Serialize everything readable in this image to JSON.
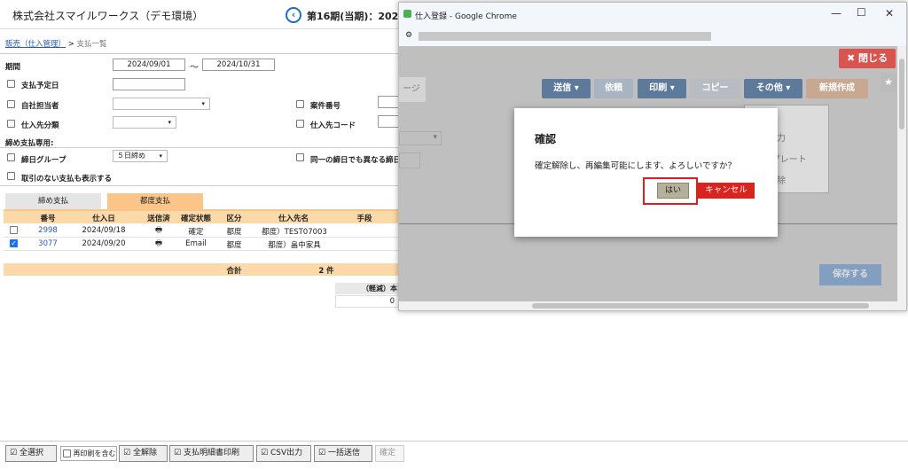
{
  "app": {
    "company": "株式会社スマイルワークス（デモ環境）",
    "period_title": "第16期(当期)：2024",
    "back_icon": "chevron-left-icon"
  },
  "breadcrumb": {
    "parent": "販売（仕入管理）",
    "separator": ">",
    "current": "支払一覧"
  },
  "filters": {
    "period_label": "期間",
    "period_from": "2024/09/01",
    "period_tilde": "～",
    "period_to": "2024/10/31",
    "due_date_label": "支払予定日",
    "staff_label": "自社担当者",
    "case_no_label": "案件番号",
    "supplier_type_label": "仕入先分類",
    "supplier_code_label": "仕入先コード",
    "closing_section": "締め支払専用:",
    "closing_group_label": "締日グループ",
    "closing_group_value": "５日締め",
    "same_closing_label": "同一の締日でも異なる締日",
    "show_no_txn_label": "取引のない支払も表示する"
  },
  "tabs": [
    "締め支払",
    "都度支払"
  ],
  "table": {
    "headers": [
      "番号",
      "仕入日",
      "送信済",
      "確定状態",
      "区分",
      "仕入先名",
      "手段"
    ],
    "rows": [
      {
        "checked": false,
        "no": "2998",
        "date": "2024/09/18",
        "status": "確定",
        "type": "都度",
        "supplier": "都度）TEST07003"
      },
      {
        "checked": true,
        "no": "3077",
        "date": "2024/09/20",
        "status": "Email",
        "type": "都度",
        "supplier": "都度）畠中家具"
      }
    ],
    "total_label": "合計",
    "total_count": "2 件",
    "subtotal_label": "（軽減）本",
    "subtotal_value": "0"
  },
  "toolbar": {
    "select_all": "全選択",
    "reprint": "再印刷を含む",
    "deselect_all": "全解除",
    "print_statement": "支払明細書印刷",
    "csv_export": "CSV出力",
    "bulk_send": "一括送信",
    "confirm": "確定"
  },
  "chrome": {
    "window_title": "仕入登録 - Google Chrome",
    "close_page": "閉じる",
    "page_partial": "ージ",
    "buttons": {
      "send": "送信",
      "request": "依頼",
      "print": "印刷",
      "copy": "コピー",
      "other": "その他",
      "new": "新規作成"
    },
    "menu_partial": [
      "力",
      "ンプレート",
      "除"
    ],
    "save": "保存する"
  },
  "dialog": {
    "title": "確認",
    "message": "確定解除し、再編集可能にします、よろしいですか？",
    "yes": "はい",
    "cancel": "キャンセル"
  },
  "colors": {
    "accent_blue": "#1a6fc4",
    "header_orange": "#fbd9a8",
    "cancel_red": "#d9231f",
    "highlight": "#e31b1b"
  }
}
